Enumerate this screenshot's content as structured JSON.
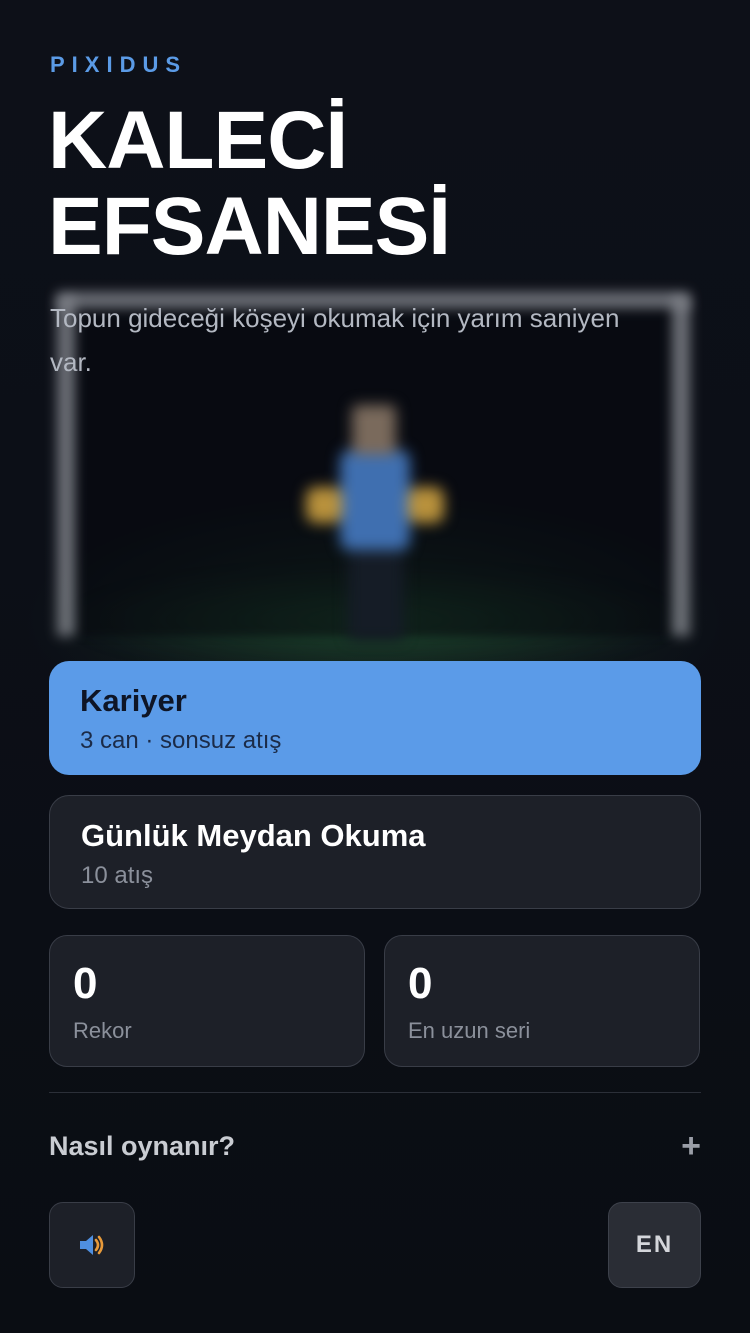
{
  "brand": "PIXIDUS",
  "title": {
    "line1": "KALECİ",
    "line2": "EFSANESİ"
  },
  "subtitle": "Topun gideceği köşeyi okumak için yarım saniyen var.",
  "modes": [
    {
      "title": "Kariyer",
      "desc": "3 can · sonsuz atış"
    },
    {
      "title": "Günlük Meydan Okuma",
      "desc": "10 atış"
    }
  ],
  "stats": [
    {
      "value": "0",
      "label": "Rekor"
    },
    {
      "value": "0",
      "label": "En uzun seri"
    }
  ],
  "howto": {
    "label": "Nasıl oynanır?",
    "icon": "plus-icon"
  },
  "controls": {
    "sound_icon": "speaker-icon",
    "language": "EN"
  },
  "colors": {
    "accent": "#5b9be8",
    "background": "#0b0e15",
    "card": "#1d2028"
  }
}
